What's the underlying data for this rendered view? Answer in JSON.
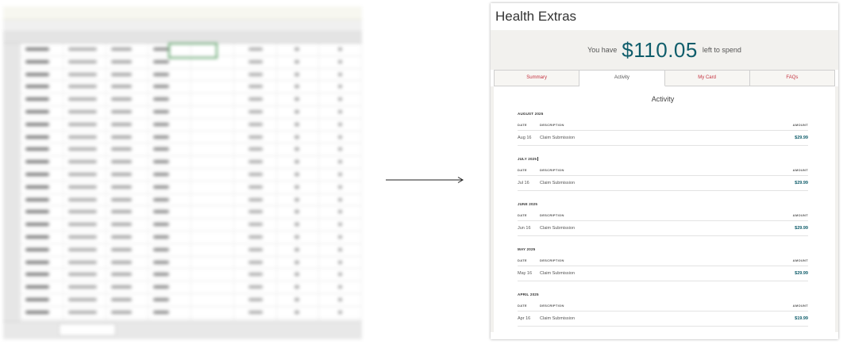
{
  "panel": {
    "title": "Health Extras",
    "balance_prefix": "You have",
    "balance_amount": "$110.05",
    "balance_suffix": "left to spend"
  },
  "tabs": [
    {
      "label": "Summary"
    },
    {
      "label": "Activity"
    },
    {
      "label": "My Card"
    },
    {
      "label": "FAQs"
    }
  ],
  "activity": {
    "title": "Activity",
    "col_date": "DATE",
    "col_description": "DESCRIPTION",
    "col_amount": "AMOUNT",
    "months": [
      {
        "name": "AUGUST 2025",
        "date": "Aug 16",
        "description": "Claim Submission",
        "amount": "$29.99"
      },
      {
        "name": "JULY 2025",
        "date": "Jul 16",
        "description": "Claim Submission",
        "amount": "$29.99"
      },
      {
        "name": "JUNE 2025",
        "date": "Jun 16",
        "description": "Claim Submission",
        "amount": "$29.99"
      },
      {
        "name": "MAY 2025",
        "date": "May 16",
        "description": "Claim Submission",
        "amount": "$29.99"
      },
      {
        "name": "APRIL 2025",
        "date": "Apr 16",
        "description": "Claim Submission",
        "amount": "$19.99"
      }
    ]
  },
  "colors": {
    "accent_teal": "#0f5d6b",
    "tab_red": "#c4323f",
    "panel_bg": "#f2f1ee"
  }
}
